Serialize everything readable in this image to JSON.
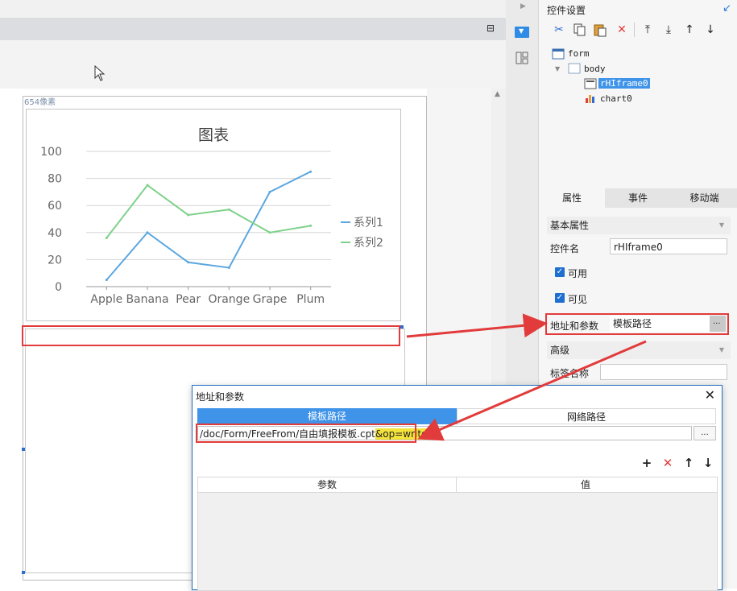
{
  "canvas": {
    "pixel_label": "654像素"
  },
  "chart_data": {
    "type": "line",
    "title": "图表",
    "categories": [
      "Apple",
      "Banana",
      "Pear",
      "Orange",
      "Grape",
      "Plum"
    ],
    "series": [
      {
        "name": "系列1",
        "values": [
          5,
          40,
          18,
          14,
          70,
          85
        ],
        "color": "#5ba7e0"
      },
      {
        "name": "系列2",
        "values": [
          36,
          75,
          53,
          57,
          40,
          45
        ],
        "color": "#7ed18a"
      }
    ],
    "ylim": [
      0,
      100
    ],
    "yticks": [
      "100",
      "80",
      "60",
      "40",
      "20",
      "0"
    ],
    "grid": true,
    "legend": "right"
  },
  "right_panel": {
    "title": "控件设置",
    "tree": {
      "form": "form",
      "body": "body",
      "iframe": "rHIframe0",
      "chart": "chart0"
    },
    "tabs": [
      "属性",
      "事件",
      "移动端"
    ],
    "sections": {
      "basic": "基本属性",
      "advanced": "高级"
    },
    "fields": {
      "name_label": "控件名",
      "name_value": "rHIframe0",
      "enabled_label": "可用",
      "visible_label": "可见",
      "url_label": "地址和参数",
      "url_value": "模板路径",
      "url_button": "···",
      "tag_label": "标签名称"
    }
  },
  "dialog": {
    "title": "地址和参数",
    "close": "✕",
    "tabs": {
      "template": "模板路径",
      "network": "网络路径"
    },
    "path_prefix": "/doc/Form/FreeFrom/自由填报模板.cpt",
    "path_highlight": "&op=write",
    "path_button": "...",
    "columns": {
      "param": "参数",
      "value": "值"
    },
    "tools": [
      "+",
      "✕",
      "↑",
      "↓"
    ]
  },
  "colors": {
    "accent": "#3f93e8",
    "highlight_red": "#e23b3b",
    "highlight_yellow": "#f4e33a"
  }
}
